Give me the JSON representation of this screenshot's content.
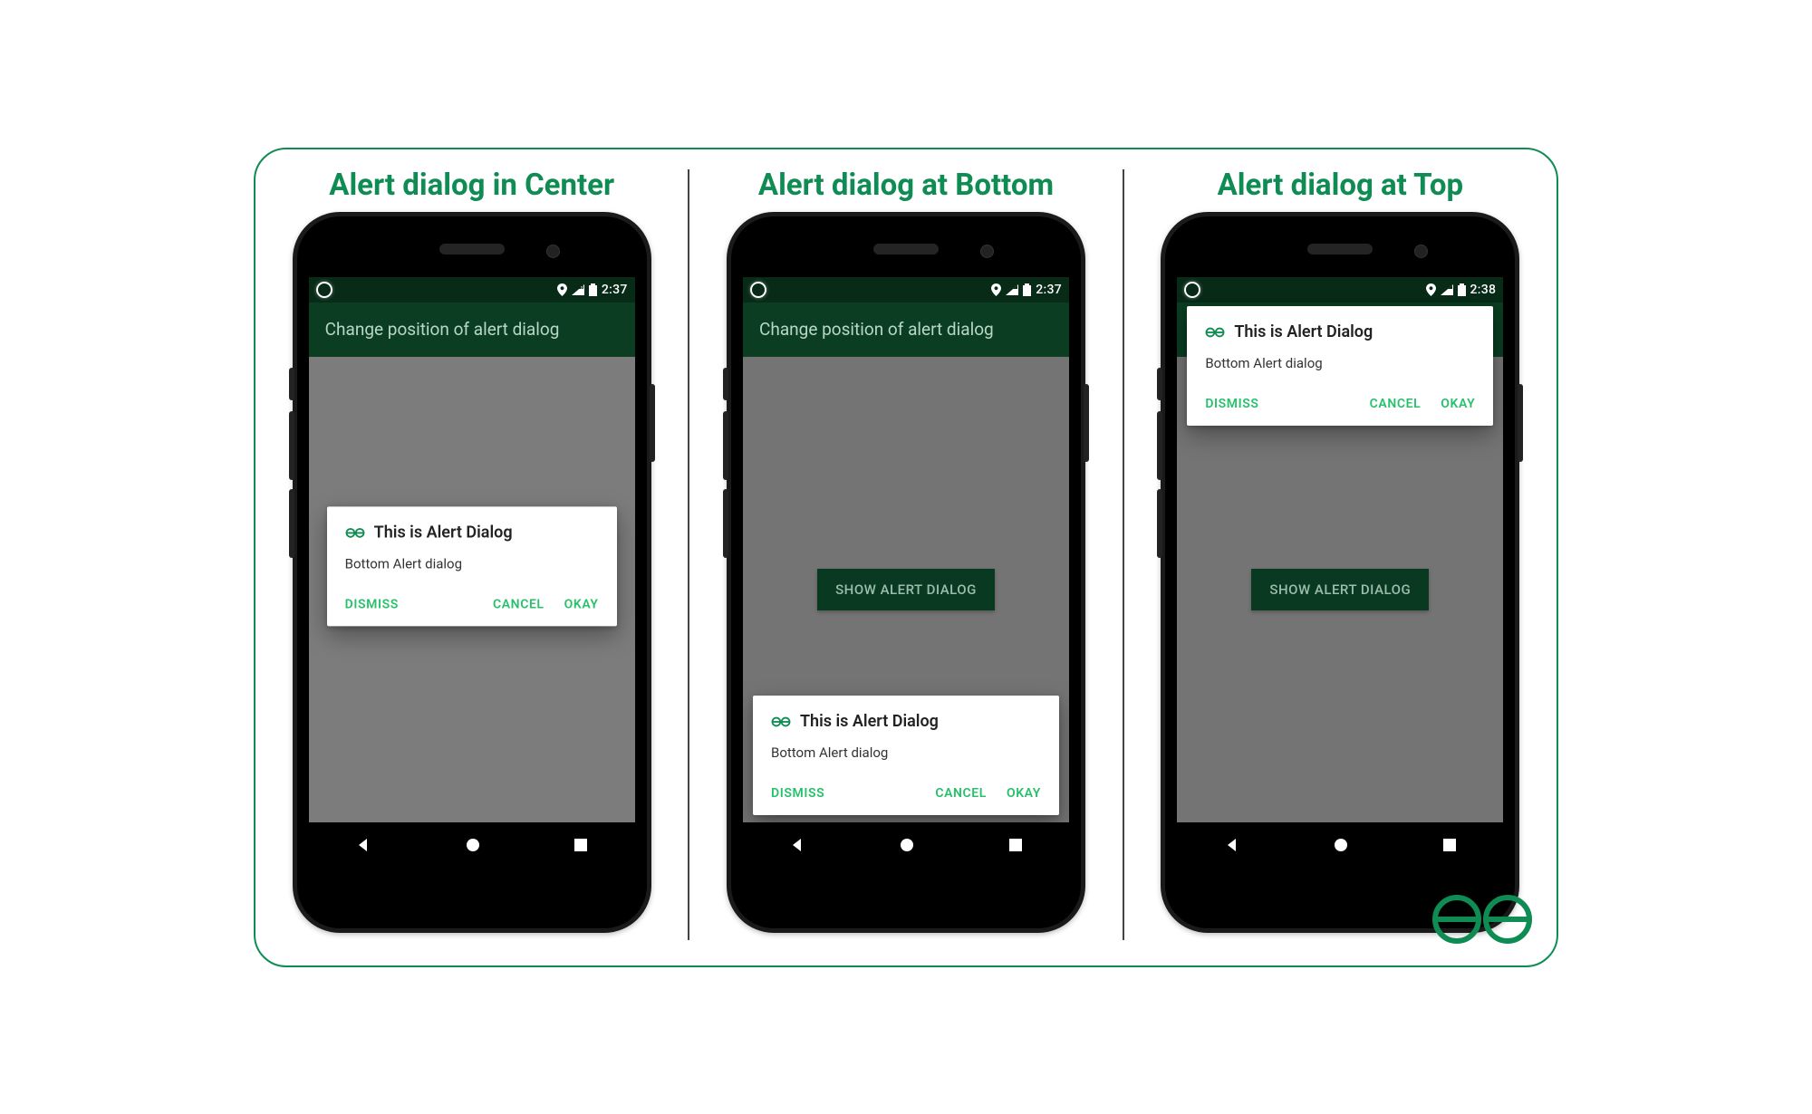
{
  "headings": {
    "center": "Alert dialog in Center",
    "bottom": "Alert dialog at Bottom",
    "top": "Alert dialog at Top"
  },
  "phones": {
    "clock_center": "2:37",
    "clock_bottom": "2:37",
    "clock_top": "2:38",
    "actionbar_title": "Change position of alert dialog",
    "show_button": "SHOW ALERT DIALOG"
  },
  "dialog": {
    "title": "This is Alert Dialog",
    "message": "Bottom Alert dialog",
    "dismiss": "DISMISS",
    "cancel": "CANCEL",
    "okay": "OKAY"
  }
}
